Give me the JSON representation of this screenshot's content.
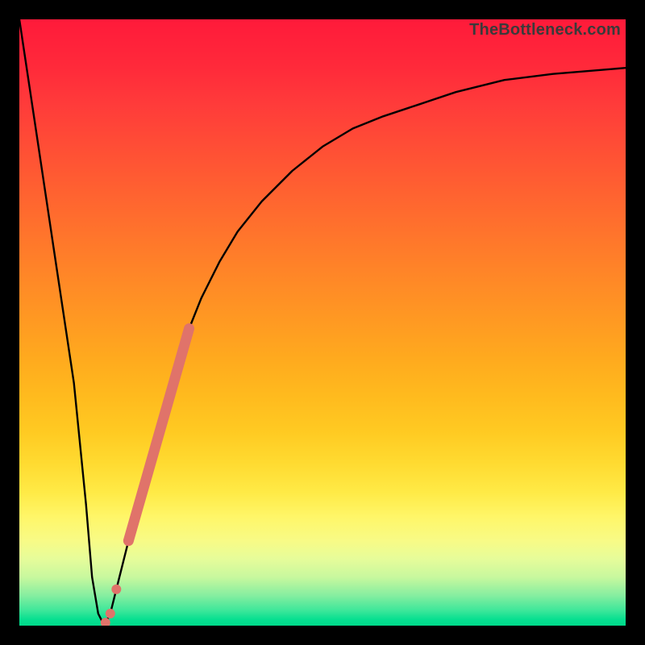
{
  "attribution": "TheBottleneck.com",
  "colors": {
    "curve": "#000000",
    "highlight": "#e0736a",
    "gradient_top": "#ff1a3a",
    "gradient_bottom": "#00da8a"
  },
  "chart_data": {
    "type": "line",
    "title": "",
    "xlabel": "",
    "ylabel": "",
    "xlim": [
      0,
      100
    ],
    "ylim": [
      0,
      100
    ],
    "series": [
      {
        "name": "bottleneck-curve",
        "x": [
          0,
          3,
          6,
          9,
          11,
          12,
          13,
          14,
          15,
          16,
          18,
          20,
          22,
          24,
          26,
          28,
          30,
          33,
          36,
          40,
          45,
          50,
          55,
          60,
          66,
          72,
          80,
          88,
          100
        ],
        "y": [
          100,
          80,
          60,
          40,
          20,
          8,
          2,
          0,
          2,
          6,
          14,
          22,
          30,
          37,
          43,
          49,
          54,
          60,
          65,
          70,
          75,
          79,
          82,
          84,
          86,
          88,
          90,
          91,
          92
        ]
      }
    ],
    "highlight": {
      "segment": {
        "x": [
          18,
          28
        ],
        "y": [
          14,
          49
        ]
      },
      "dots": [
        {
          "x": 16.0,
          "y": 6.0
        },
        {
          "x": 15.0,
          "y": 2.0
        },
        {
          "x": 14.2,
          "y": 0.5
        }
      ],
      "dot_radius": 6
    },
    "background_bands_percent": [
      {
        "color": "red-orange",
        "from": 0,
        "to": 78
      },
      {
        "color": "yellow",
        "from": 78,
        "to": 92
      },
      {
        "color": "green",
        "from": 92,
        "to": 100
      }
    ]
  }
}
